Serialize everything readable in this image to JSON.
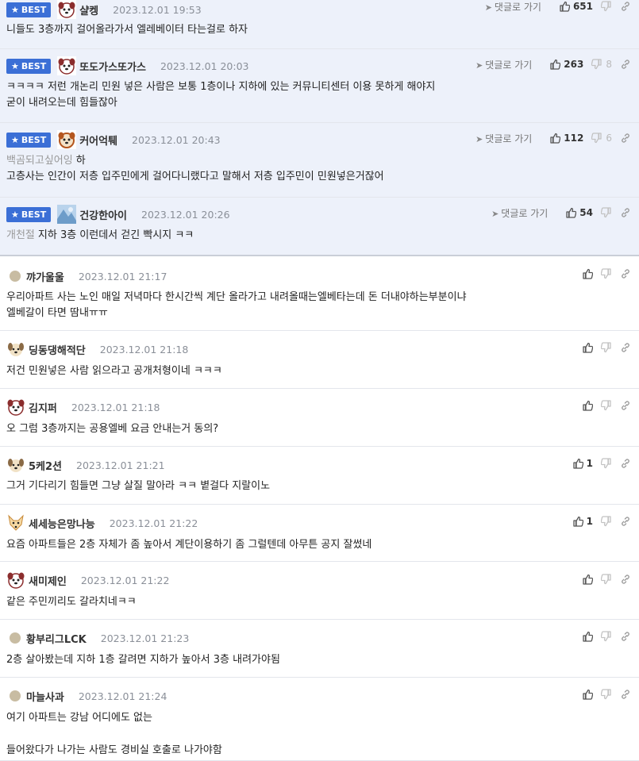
{
  "labels": {
    "best": "BEST",
    "reply": "댓글로 가기"
  },
  "best_comments": [
    {
      "nick": "샬켕",
      "time": "2023.12.01 19:53",
      "likes": "651",
      "dislikes": "",
      "avatar": "dog-face",
      "lines": [
        "니들도 3층까지 걸어올라가서 엘레베이터 타는걸로 하자"
      ]
    },
    {
      "nick": "또도가스또가스",
      "time": "2023.12.01 20:03",
      "likes": "263",
      "dislikes": "8",
      "avatar": "dog-face",
      "lines": [
        "ㅋㅋㅋㅋ 저런 개논리 민원 넣은 사람은 보통 1층이나 지하에 있는 커뮤니티센터 이용 못하게 해야지",
        "굳이 내려오는데 힘들잖아"
      ]
    },
    {
      "nick": "커어억퉤",
      "time": "2023.12.01 20:43",
      "likes": "112",
      "dislikes": "6",
      "avatar": "dog-face-brown",
      "mention": "백곰되고싶어잉",
      "mention_text": "하",
      "lines": [
        "고층사는 인간이 저층 입주민에게 걸어다니랬다고 말해서 저층 입주민이 민원넣은거잖어"
      ]
    },
    {
      "nick": "건강한아이",
      "time": "2023.12.01 20:26",
      "likes": "54",
      "dislikes": "",
      "avatar": "blue-pattern",
      "mention": "개천절",
      "mention_text": "지하 3층 이런데서 걷긴 빡시지 ㅋㅋ",
      "lines": []
    }
  ],
  "comments": [
    {
      "nick": "꺄가울울",
      "time": "2023.12.01 21:17",
      "likes": "",
      "avatar": "dot",
      "lines": [
        "우리아파트 사는 노인 매일 저녁마다 한시간씩 계단 올라가고 내려올때는엘베타는데 돈 더내야하는부분이냐",
        "엘베갈이 타면 땀내ㅠㅠ"
      ]
    },
    {
      "nick": "딩동댕해적단",
      "time": "2023.12.01 21:18",
      "likes": "",
      "avatar": "puppy",
      "lines": [
        "저건 민원넣은 사람 읽으라고 공개처형이네 ㅋㅋㅋ"
      ]
    },
    {
      "nick": "김지퍼",
      "time": "2023.12.01 21:18",
      "likes": "",
      "avatar": "dog-face",
      "lines": [
        "오 그럼 3층까지는 공용엘베 요금 안내는거 동의?"
      ]
    },
    {
      "nick": "5케2션",
      "time": "2023.12.01 21:21",
      "likes": "1",
      "avatar": "puppy",
      "lines": [
        "그거 기다리기 힘들면 그냥 살질 말아라 ㅋㅋ 볕걸다 지랄이노"
      ]
    },
    {
      "nick": "세세능은망나능",
      "time": "2023.12.01 21:22",
      "likes": "1",
      "avatar": "fox",
      "lines": [
        "요즘 아파트들은 2층 자체가 좀 높아서 계단이용하기 좀 그럴텐데 아무튼 공지 잘썼네"
      ]
    },
    {
      "nick": "새미제인",
      "time": "2023.12.01 21:22",
      "likes": "",
      "avatar": "dog-face",
      "lines": [
        "같은 주민끼리도 갈라치네ㅋㅋ"
      ]
    },
    {
      "nick": "황부리그LCK",
      "time": "2023.12.01 21:23",
      "likes": "",
      "avatar": "dot",
      "lines": [
        "2층 살아봤는데 지하 1층 갈려면 지하가 높아서 3층 내려가야됨"
      ]
    },
    {
      "nick": "마늘사과",
      "time": "2023.12.01 21:24",
      "likes": "",
      "avatar": "dot",
      "lines": [
        "여기 아파트는 강남 어디에도 없는",
        "",
        "들어왔다가 나가는 사람도 경비실 호출로 나가야함"
      ]
    }
  ],
  "colors": {
    "best_bg": "#edf1fa",
    "badge": "#3b6fd6"
  }
}
